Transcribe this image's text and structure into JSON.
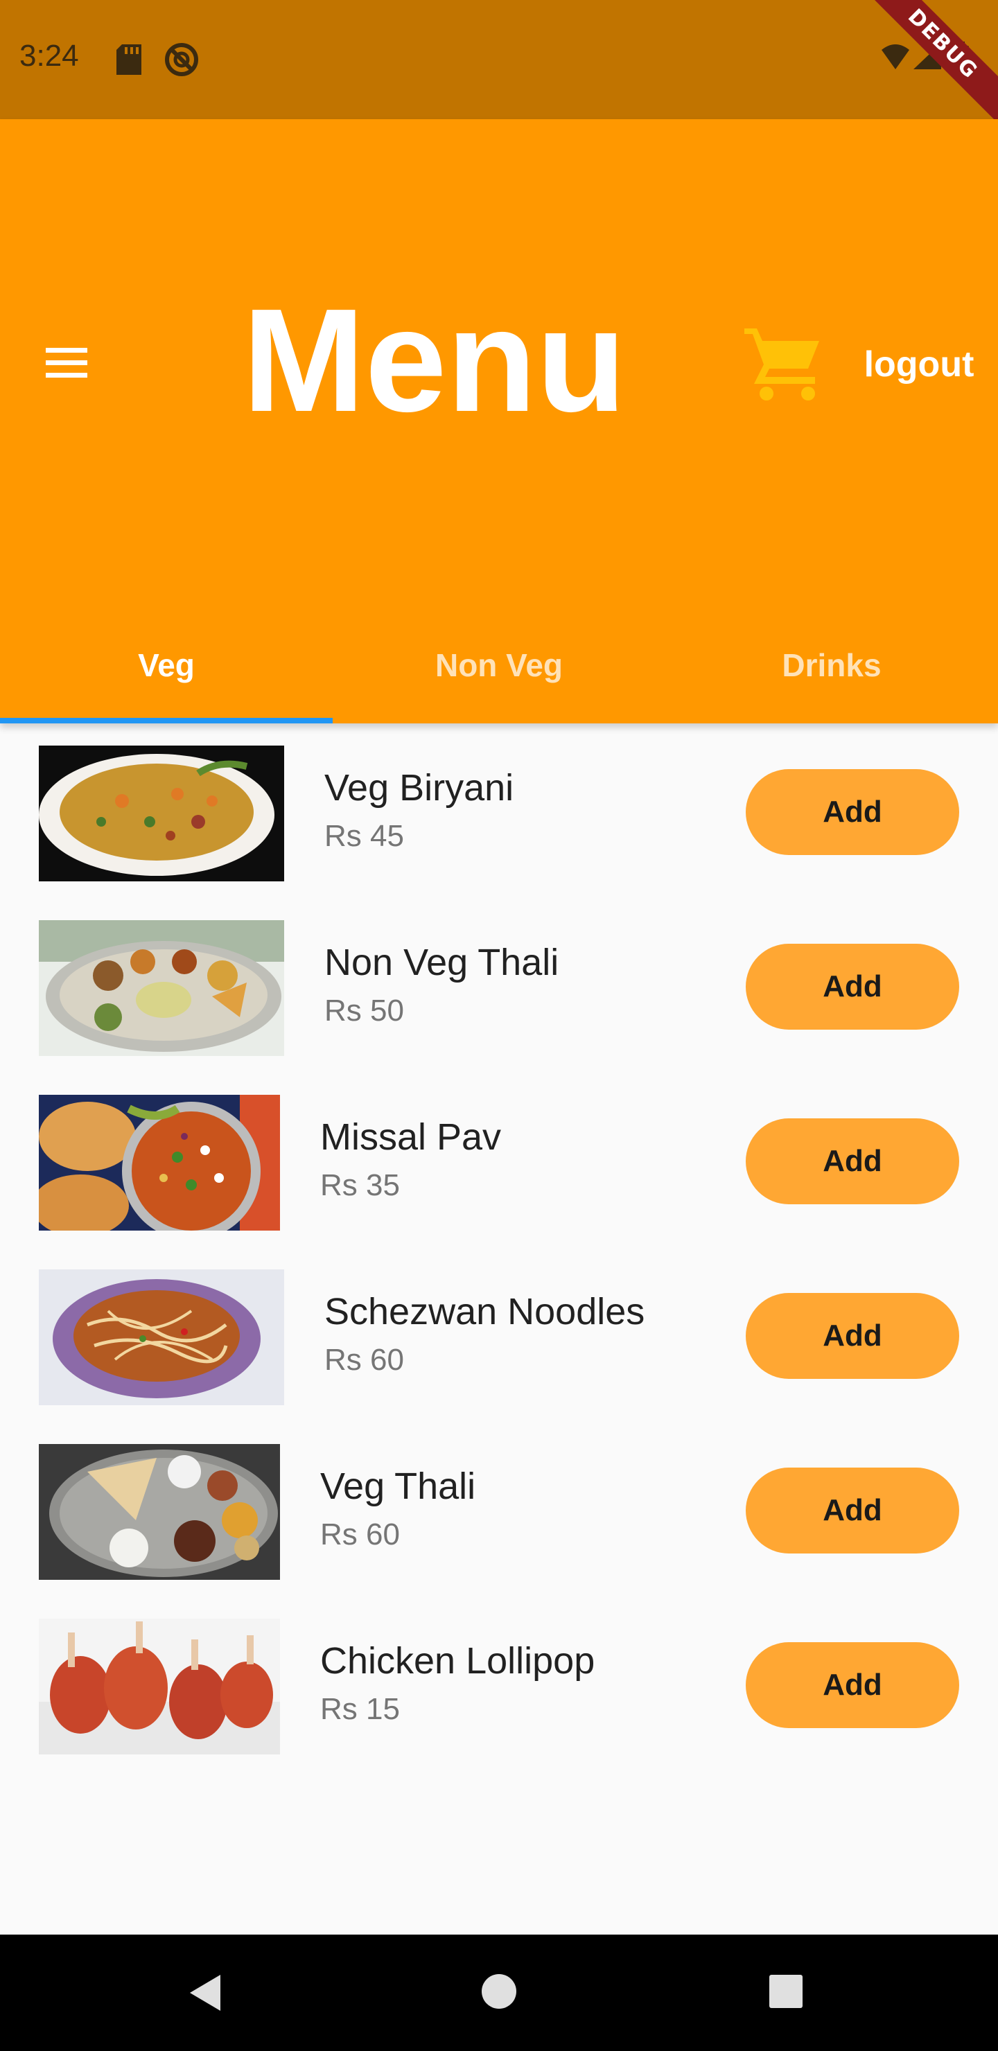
{
  "status_bar": {
    "time": "3:24",
    "icons": [
      "sd-card-icon",
      "do-not-disturb-icon",
      "wifi-icon",
      "signal-icon",
      "battery-icon"
    ],
    "debug_label": "DEBUG",
    "bg_color": "#c17400"
  },
  "app_bar": {
    "title": "Menu",
    "menu_icon": "hamburger-menu-icon",
    "cart_icon": "shopping-cart-icon",
    "cart_color": "#ffc107",
    "logout_label": "logout",
    "bg_color": "#ff9800"
  },
  "tabs": [
    {
      "label": "Veg",
      "active": true
    },
    {
      "label": "Non Veg",
      "active": false
    },
    {
      "label": "Drinks",
      "active": false
    }
  ],
  "tab_indicator_color": "#2196f3",
  "menu_items": [
    {
      "name": "Veg Biryani",
      "price": "Rs 45",
      "image": "veg-biryani-photo",
      "add_label": "Add"
    },
    {
      "name": "Non Veg Thali",
      "price": "Rs 50",
      "image": "non-veg-thali-photo",
      "add_label": "Add"
    },
    {
      "name": "Missal Pav",
      "price": "Rs 35",
      "image": "missal-pav-photo",
      "add_label": "Add"
    },
    {
      "name": "Schezwan Noodles",
      "price": "Rs 60",
      "image": "schezwan-noodles-photo",
      "add_label": "Add"
    },
    {
      "name": "Veg Thali",
      "price": "Rs 60",
      "image": "veg-thali-photo",
      "add_label": "Add"
    },
    {
      "name": "Chicken Lollipop",
      "price": "Rs 15",
      "image": "chicken-lollipop-photo",
      "add_label": "Add"
    }
  ],
  "add_button_color": "#ffa733",
  "nav_bar": {
    "icons": [
      "back-icon",
      "home-icon",
      "recents-icon"
    ]
  }
}
